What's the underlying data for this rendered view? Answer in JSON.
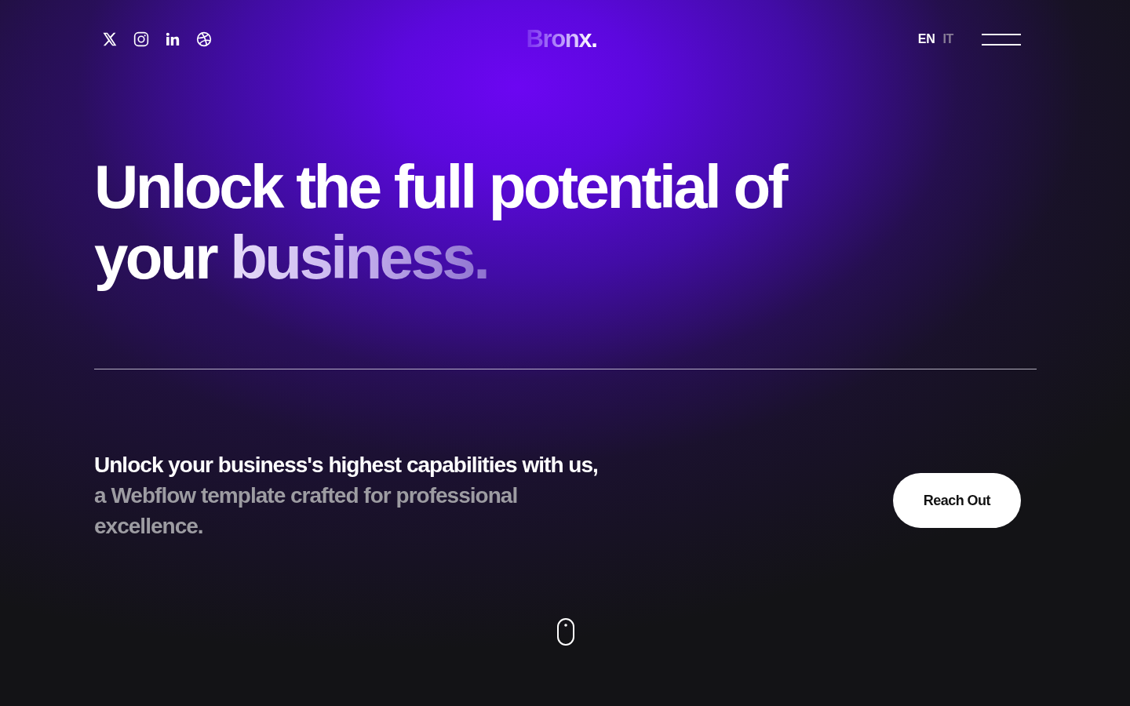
{
  "header": {
    "social_links": [
      {
        "kind": "x"
      },
      {
        "kind": "instagram"
      },
      {
        "kind": "linkedin"
      },
      {
        "kind": "dribbble"
      }
    ],
    "logo": "Bronx.",
    "languages": [
      {
        "label": "EN",
        "selected": true
      },
      {
        "label": "IT",
        "selected": false
      }
    ]
  },
  "hero": {
    "heading": "Unlock the full potential of your",
    "heading_highlight": "business."
  },
  "intro": {
    "lead": "Unlock your business's highest capabilities with us,",
    "text": "a Webflow template crafted for professional excellence.",
    "button": "Reach Out"
  }
}
